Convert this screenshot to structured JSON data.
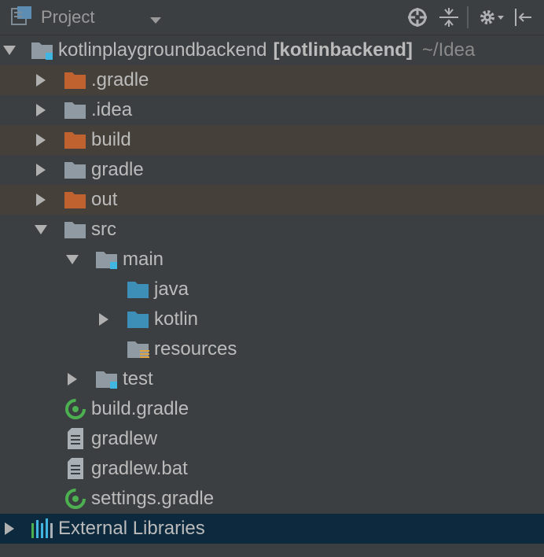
{
  "toolbar": {
    "title": "Project",
    "icons": [
      "project-view-icon",
      "dropdown-caret-icon",
      "locate-icon",
      "collapse-all-icon",
      "settings-icon",
      "hide-panel-icon"
    ]
  },
  "tree": {
    "root": {
      "label": "kotlinplaygroundbackend",
      "module": "[kotlinbackend]",
      "path": "~/Idea"
    },
    "items": [
      {
        "label": ".gradle"
      },
      {
        "label": ".idea"
      },
      {
        "label": "build"
      },
      {
        "label": "gradle"
      },
      {
        "label": "out"
      },
      {
        "label": "src"
      },
      {
        "label": "main"
      },
      {
        "label": "java"
      },
      {
        "label": "kotlin"
      },
      {
        "label": "resources"
      },
      {
        "label": "test"
      },
      {
        "label": "build.gradle"
      },
      {
        "label": "gradlew"
      },
      {
        "label": "gradlew.bat"
      },
      {
        "label": "settings.gradle"
      }
    ],
    "external": {
      "label": "External Libraries"
    }
  },
  "colors": {
    "background": "#3c3f41",
    "excluded_row": "#45413a",
    "selected_row": "#0d293e",
    "excluded_folder": "#c0622f",
    "folder": "#8f9aa3",
    "source_folder": "#3d8fb8",
    "module_marker": "#40b6e0",
    "gradle_green": "#4caf50"
  }
}
